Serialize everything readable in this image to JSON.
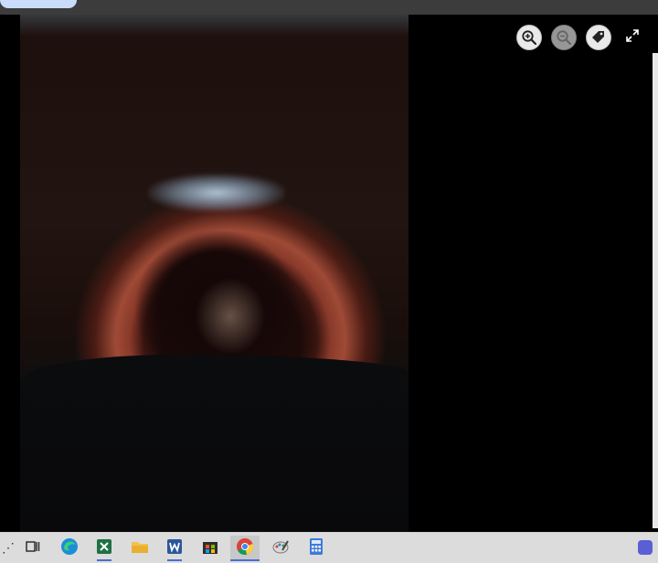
{
  "viewer": {
    "image_description_icon": "eye-photo",
    "controls": [
      {
        "name": "zoom-in",
        "icon": "zoom-in-icon"
      },
      {
        "name": "zoom-out",
        "icon": "zoom-out-icon",
        "disabled": true
      },
      {
        "name": "tag",
        "icon": "tag-icon"
      },
      {
        "name": "fullscreen",
        "icon": "expand-icon"
      }
    ]
  },
  "taskbar": {
    "items": [
      {
        "name": "task-view",
        "icon": "task-view-icon"
      },
      {
        "name": "edge",
        "icon": "edge-icon"
      },
      {
        "name": "excel",
        "icon": "excel-icon"
      },
      {
        "name": "file-explorer",
        "icon": "folder-icon"
      },
      {
        "name": "word",
        "icon": "word-icon"
      },
      {
        "name": "store",
        "icon": "store-icon"
      },
      {
        "name": "chrome",
        "icon": "chrome-icon",
        "active": true
      },
      {
        "name": "paint",
        "icon": "paint-icon"
      },
      {
        "name": "calculator",
        "icon": "calculator-icon"
      }
    ],
    "overflow_text": "⋰"
  },
  "colors": {
    "taskbar_bg": "#dcdcdc",
    "accent": "#4a6fd1",
    "topbar": "#3c3c3c"
  }
}
